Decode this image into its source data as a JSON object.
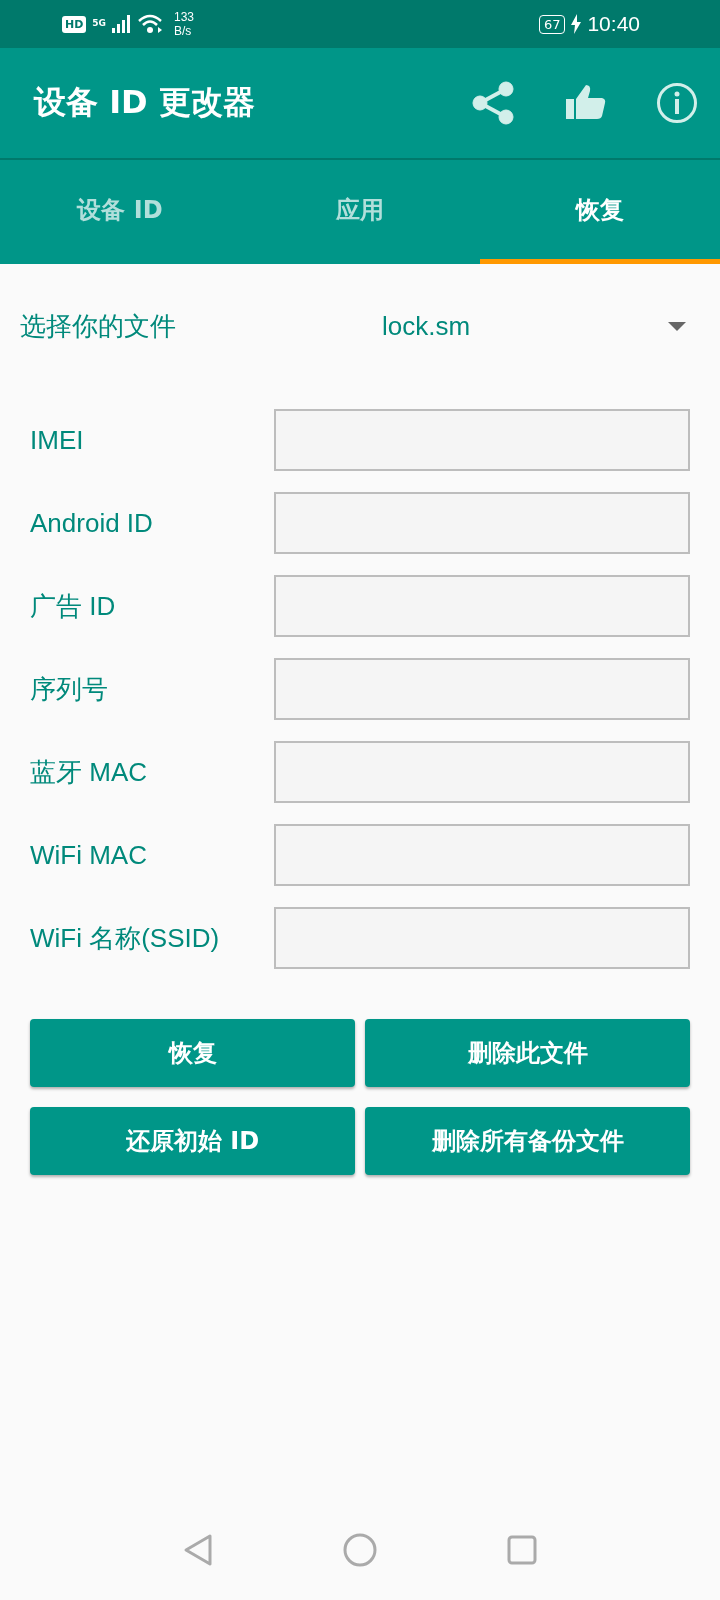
{
  "status_bar": {
    "hd": "HD",
    "network": "5G",
    "speed_value": "133",
    "speed_unit": "B/s",
    "battery": "67",
    "time": "10:40"
  },
  "app_bar": {
    "title": "设备 ID 更改器"
  },
  "tabs": [
    {
      "label": "设备 ID",
      "selected": false
    },
    {
      "label": "应用",
      "selected": false
    },
    {
      "label": "恢复",
      "selected": true
    }
  ],
  "file_selector": {
    "label": "选择你的文件",
    "value": "lock.sm"
  },
  "fields": [
    {
      "label": "IMEI"
    },
    {
      "label": "Android ID"
    },
    {
      "label": "广告 ID"
    },
    {
      "label": "序列号"
    },
    {
      "label": "蓝牙 MAC"
    },
    {
      "label": "WiFi MAC"
    },
    {
      "label": "WiFi 名称(SSID)"
    }
  ],
  "buttons": [
    "恢复",
    "删除此文件",
    "还原初始 ID",
    "删除所有备份文件"
  ]
}
